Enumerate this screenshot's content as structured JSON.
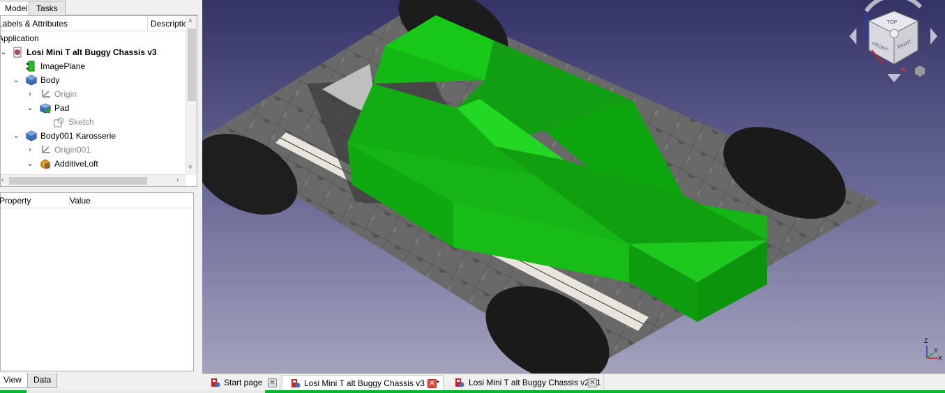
{
  "combo_tabs": [
    "Model",
    "Tasks"
  ],
  "tree": {
    "headers": {
      "labels": "Labels & Attributes",
      "description": "Description"
    },
    "root": "Application",
    "items": [
      {
        "label": "Losi Mini T alt Buggy Chassis v3",
        "icon": "document-icon",
        "arrow": "expanded"
      },
      {
        "label": "ImagePlane",
        "icon": "image-plane-icon",
        "arrow": ""
      },
      {
        "label": "Body",
        "icon": "body-icon",
        "arrow": "expanded"
      },
      {
        "label": "Origin",
        "icon": "origin-icon",
        "arrow": "collapsed"
      },
      {
        "label": "Pad",
        "icon": "pad-icon",
        "arrow": "expanded"
      },
      {
        "label": "Sketch",
        "icon": "sketch-icon",
        "arrow": ""
      },
      {
        "label": "Body001 Karosserie",
        "icon": "body-icon",
        "arrow": "expanded"
      },
      {
        "label": "Origin001",
        "icon": "origin-icon",
        "arrow": "collapsed"
      },
      {
        "label": "AdditiveLoft",
        "icon": "additive-loft-icon",
        "arrow": "expanded"
      }
    ]
  },
  "properties": {
    "col_property": "Property",
    "col_value": "Value"
  },
  "property_tabs": [
    "View",
    "Data"
  ],
  "navcube": {
    "faces": [
      "TOP",
      "FRONT",
      "RIGHT"
    ],
    "axes": [
      "Z",
      "Y",
      "X"
    ]
  },
  "mdi_tabs": [
    {
      "label": "Start page",
      "active": false
    },
    {
      "label": "Losi Mini T alt Buggy Chassis v3 : 1*",
      "active": true
    },
    {
      "label": "Losi Mini T alt Buggy Chassis v2 : 1",
      "active": false
    }
  ],
  "colors": {
    "body_green": "#12c412",
    "progress": "#07b531",
    "close_active": "#e84a3f"
  }
}
